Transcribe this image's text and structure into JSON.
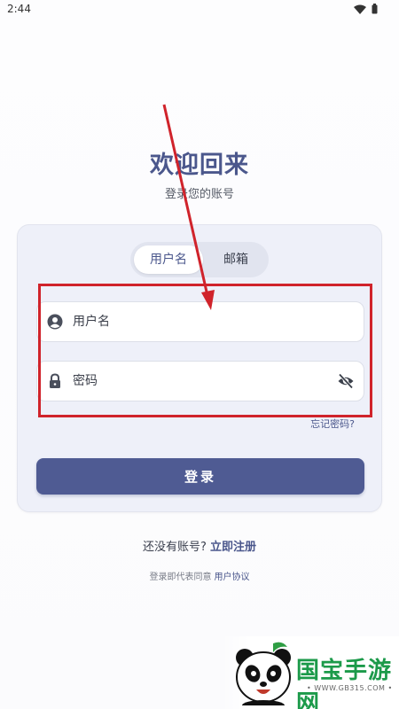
{
  "status_bar": {
    "time": "2:44"
  },
  "header": {
    "title": "欢迎回来",
    "subtitle": "登录您的账号"
  },
  "tabs": [
    {
      "label": "用户名",
      "selected": true
    },
    {
      "label": "邮箱",
      "selected": false
    }
  ],
  "form": {
    "username": {
      "placeholder": "用户名",
      "value": ""
    },
    "password": {
      "placeholder": "密码",
      "value": ""
    },
    "forgot_label": "忘记密码?",
    "login_label": "登录"
  },
  "footer": {
    "register_prompt": "还没有账号?",
    "register_link": "立即注册",
    "agreement_prefix": "登录即代表同意",
    "agreement_link": "用户协议"
  },
  "watermark": {
    "name": "国宝手游网",
    "url": "• WWW.GB315.COM •"
  },
  "colors": {
    "accent": "#4f5b93",
    "title": "#4b578c",
    "annotation": "#d0232b",
    "watermark": "#1c9a4a"
  },
  "icons": {
    "username_field": "user-circle-icon",
    "password_field": "lock-icon",
    "password_toggle": "eye-off-icon"
  }
}
